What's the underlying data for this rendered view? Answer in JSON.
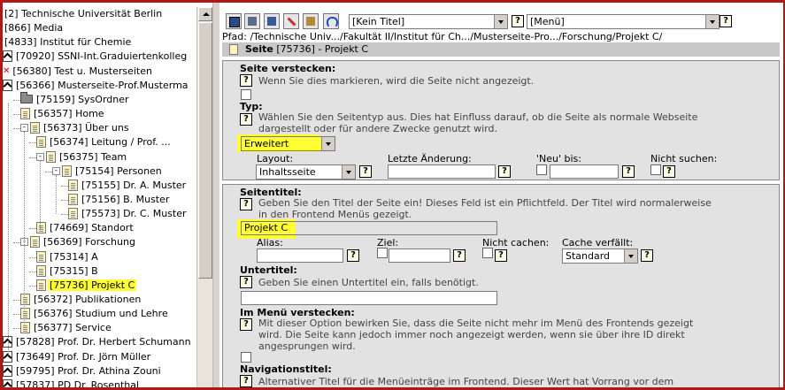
{
  "tree": {
    "items": [
      {
        "label": "[2] Technische Universität Berlin",
        "indent": 0,
        "icon": "none",
        "selected": false
      },
      {
        "label": "[866] Media",
        "indent": 0,
        "icon": "none",
        "selected": false
      },
      {
        "label": "[4833] Institut für Chemie",
        "indent": 0,
        "icon": "none",
        "selected": false
      },
      {
        "label": "[70920] SSNI-Int.Graduiertenkolleg",
        "indent": 0,
        "icon": "shortcut",
        "selected": false
      },
      {
        "label": "[56380] Test u. Musterseiten",
        "indent": 0,
        "icon": "hidden",
        "selected": false
      },
      {
        "label": "[56366] Musterseite-Prof.Musterma",
        "indent": 0,
        "icon": "shortcut",
        "selected": false
      },
      {
        "label": "[75159] SysOrdner",
        "indent": 1,
        "icon": "folder",
        "selected": false
      },
      {
        "label": "[56357] Home",
        "indent": 1,
        "icon": "page",
        "selected": false
      },
      {
        "label": "[56373] Über uns",
        "indent": 1,
        "icon": "page",
        "pm": "-",
        "selected": false
      },
      {
        "label": "[56374] Leitung / Prof. ...",
        "indent": 2,
        "icon": "page",
        "selected": false
      },
      {
        "label": "[56375] Team",
        "indent": 2,
        "icon": "page",
        "pm": "-",
        "selected": false
      },
      {
        "label": "[75154] Personen",
        "indent": 3,
        "icon": "page",
        "pm": "-",
        "selected": false
      },
      {
        "label": "[75155] Dr. A. Muster",
        "indent": 4,
        "icon": "page",
        "selected": false
      },
      {
        "label": "[75156] B. Muster",
        "indent": 4,
        "icon": "page",
        "selected": false
      },
      {
        "label": "[75573] Dr. C. Muster",
        "indent": 4,
        "icon": "page",
        "selected": false
      },
      {
        "label": "[74669] Standort",
        "indent": 2,
        "icon": "page",
        "selected": false
      },
      {
        "label": "[56369] Forschung",
        "indent": 1,
        "icon": "page",
        "pm": "-",
        "selected": false
      },
      {
        "label": "[75314] A",
        "indent": 2,
        "icon": "page",
        "selected": false
      },
      {
        "label": "[75315] B",
        "indent": 2,
        "icon": "page",
        "selected": false
      },
      {
        "label": "[75736] Projekt C",
        "indent": 2,
        "icon": "page",
        "selected": true
      },
      {
        "label": "[56372] Publikationen",
        "indent": 1,
        "icon": "page",
        "selected": false
      },
      {
        "label": "[56376] Studium und Lehre",
        "indent": 1,
        "icon": "page",
        "selected": false
      },
      {
        "label": "[56377] Service",
        "indent": 1,
        "icon": "page",
        "selected": false
      },
      {
        "label": "[57828] Prof. Dr. Herbert Schumann",
        "indent": 0,
        "icon": "shortcut",
        "selected": false
      },
      {
        "label": "[73649] Prof. Dr. Jörn Müller",
        "indent": 0,
        "icon": "shortcut",
        "selected": false
      },
      {
        "label": "[59795] Prof. Dr. Athina Zouni",
        "indent": 0,
        "icon": "shortcut",
        "selected": false
      },
      {
        "label": "[57837] PD Dr. Rosenthal",
        "indent": 0,
        "icon": "shortcut",
        "selected": false
      }
    ]
  },
  "toolbar": {
    "title_select": "[Kein Titel]",
    "menu_select": "[Menü]",
    "help": "?"
  },
  "path": {
    "label": "Pfad:",
    "value": "/Technische Univ.../Fakultät II/Institut für Ch.../Musterseite-Pro.../Forschung/Projekt C/"
  },
  "page_header": {
    "key": "Seite",
    "value": "[75736] - Projekt C"
  },
  "sections": {
    "hide_page": {
      "label": "Seite verstecken:",
      "desc": "Wenn Sie dies markieren, wird die Seite nicht angezeigt."
    },
    "type": {
      "label": "Typ:",
      "desc": "Wählen Sie den Seitentyp aus. Dies hat Einfluss darauf, ob die Seite als normale Webseite dargestellt oder für andere Zwecke genutzt wird.",
      "value": "Erweitert",
      "layout_label": "Layout:",
      "layout_value": "Inhaltsseite",
      "last_change_label": "Letzte Änderung:",
      "new_until_label": "'Neu' bis:",
      "no_search_label": "Nicht suchen:"
    },
    "title": {
      "label": "Seitentitel:",
      "desc": "Geben Sie den Titel der Seite ein! Dieses Feld ist ein Pflichtfeld. Der Titel wird normalerweise in den Frontend Menüs gezeigt.",
      "value": "Projekt C",
      "alias_label": "Alias:",
      "target_label": "Ziel:",
      "no_cache_label": "Nicht cachen:",
      "cache_expires_label": "Cache verfällt:",
      "cache_expires_value": "Standard"
    },
    "subtitle": {
      "label": "Untertitel:",
      "desc": "Geben Sie einen Untertitel ein, falls benötigt."
    },
    "hide_in_menu": {
      "label": "Im Menü verstecken:",
      "desc": "Mit dieser Option bewirken Sie, dass die Seite nicht mehr im Menü des Frontends gezeigt wird. Die Seite kann jedoch immer noch angezeigt werden, wenn sie über ihre ID direkt angesprungen wird."
    },
    "nav_title": {
      "label": "Navigationstitel:",
      "desc": "Alternativer Titel für die Menüeinträge im Frontend. Dieser Wert hat Vorrang vor dem"
    }
  },
  "colors": {
    "highlight": "#ffff33",
    "frame": "#b01818",
    "section_bg": "#e2e2e2",
    "header_bg": "#c8c8c8"
  }
}
